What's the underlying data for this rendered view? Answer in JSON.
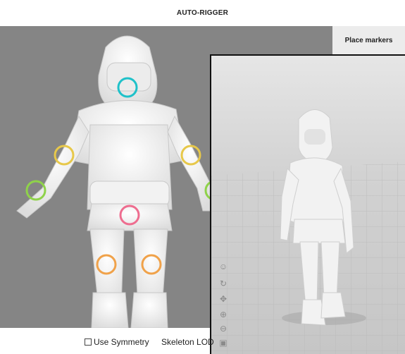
{
  "app": {
    "title": "AUTO-RIGGER"
  },
  "panel": {
    "place_markers_label": "Place markers"
  },
  "options": {
    "symmetry_label": "Use Symmetry",
    "symmetry_checked": false,
    "skeleton_lod_label": "Skeleton LOD"
  },
  "markers": [
    {
      "name": "chin",
      "color": "#1fc1c9"
    },
    {
      "name": "left-elbow",
      "color": "#e7c84a"
    },
    {
      "name": "right-elbow",
      "color": "#e7c84a"
    },
    {
      "name": "left-wrist",
      "color": "#8fd24a"
    },
    {
      "name": "right-wrist",
      "color": "#8fd24a"
    },
    {
      "name": "groin",
      "color": "#ee6d8f"
    },
    {
      "name": "left-knee",
      "color": "#f0a24a"
    },
    {
      "name": "right-knee",
      "color": "#f0a24a"
    }
  ],
  "preview_tools": [
    "head-icon",
    "rotate-icon",
    "move-icon",
    "zoom-in-icon",
    "zoom-out-icon",
    "frame-icon"
  ]
}
